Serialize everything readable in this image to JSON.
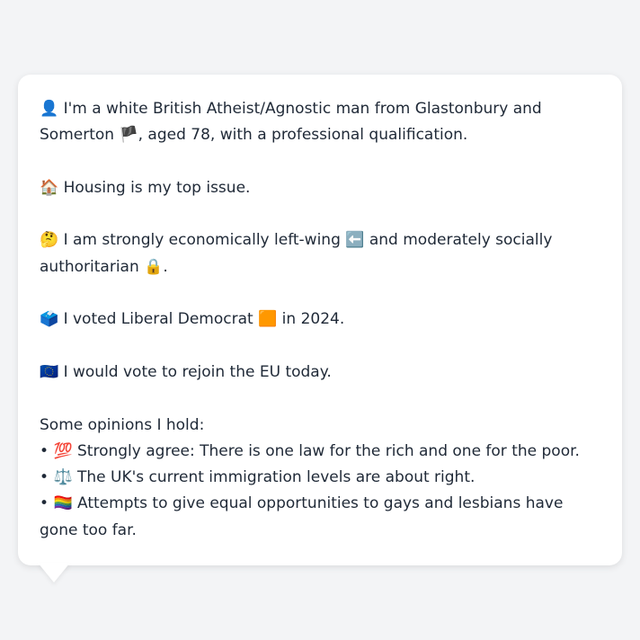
{
  "profile": {
    "intro_icon": "👤",
    "intro_text": "I'm a white British Atheist/Agnostic man from Glastonbury and Somerton",
    "intro_flag": "🏴",
    "intro_rest": ", aged 78, with a professional qualification.",
    "housing_icon": "🏠",
    "housing_text": "Housing is my top issue.",
    "politics_icon": "🤔",
    "politics_text_1": "I am strongly economically left-wing",
    "politics_left_icon": "⬅️",
    "politics_text_2": "and moderately socially",
    "politics_text_3": "authoritarian",
    "politics_lock_icon": "🔒",
    "politics_end": ".",
    "vote_icon": "🗳️",
    "vote_text_1": "I voted Liberal Democrat",
    "vote_party_icon": "🟧",
    "vote_text_2": "in 2024.",
    "eu_icon": "🇪🇺",
    "eu_text": "I would vote to rejoin the EU today.",
    "opinions_heading": "Some opinions I hold:",
    "opinions": [
      {
        "bullet": "•",
        "icon": "💯",
        "text": "Strongly agree: There is one law for the rich and one for the poor."
      },
      {
        "bullet": "•",
        "icon": "⚖️",
        "text": "The UK's current immigration levels are about right."
      },
      {
        "bullet": "•",
        "icon": "🏳️‍🌈",
        "text": "Attempts to give equal opportunities to gays and lesbians have gone too far."
      }
    ]
  },
  "colors": {
    "background": "#f3f4f6",
    "bubble": "#ffffff",
    "text": "#1f2937"
  }
}
